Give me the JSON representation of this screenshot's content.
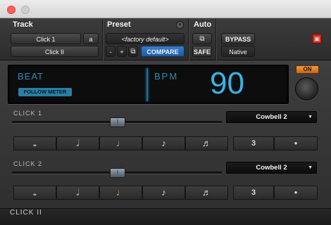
{
  "header": {
    "track_label": "Track",
    "preset_label": "Preset",
    "auto_label": "Auto",
    "track_name": "Click 1",
    "track_selector": "a",
    "insert_name": "Click II",
    "preset_value": "<factory default>",
    "minus": "-",
    "plus": "+",
    "compare": "COMPARE",
    "safe": "SAFE",
    "bypass": "BYPASS",
    "native": "Native"
  },
  "display": {
    "beat_label": "BEAT",
    "follow_meter": "FOLLOW METER",
    "bpm_label": "BPM",
    "bpm_value": "90"
  },
  "on_button": "ON",
  "clicks": [
    {
      "label": "CLICK 1",
      "sound": "Cowbell 2",
      "notes": [
        "𝅝",
        "𝅗𝅥",
        "♩",
        "♪",
        "♬"
      ],
      "extras": [
        "3",
        "•"
      ],
      "selected_note_index": 2
    },
    {
      "label": "CLICK 2",
      "sound": "Cowbell 2",
      "notes": [
        "𝅝",
        "𝅗𝅥",
        "♩",
        "♪",
        "♬"
      ],
      "extras": [
        "3",
        "•"
      ],
      "selected_note_index": 2
    }
  ],
  "footer_name": "CLICK II",
  "colors": {
    "accent_blue": "#39b3e4",
    "compare_blue": "#2a6ab5",
    "on_orange": "#e0842c",
    "selected_note": "#f1a85a",
    "close_red": "#c9261f"
  }
}
